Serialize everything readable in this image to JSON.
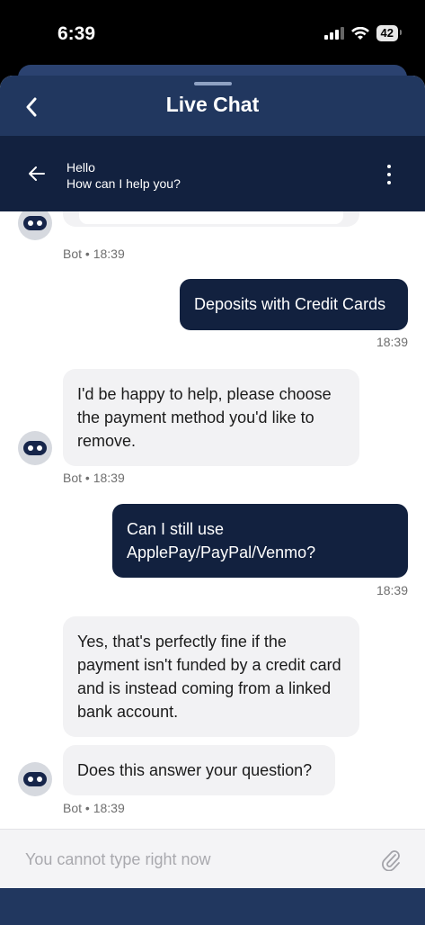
{
  "status_bar": {
    "time": "6:39",
    "battery": "42"
  },
  "header": {
    "title": "Live Chat"
  },
  "subheader": {
    "title": "Hello",
    "subtitle": "How can I help you?"
  },
  "messages": [
    {
      "sender": "Bot",
      "time": "18:39"
    },
    {
      "sender": "user",
      "text": "Deposits with Credit Cards",
      "time": "18:39"
    },
    {
      "sender": "Bot",
      "text": "I'd be happy to help, please choose the payment method you'd like to remove.",
      "time": "18:39"
    },
    {
      "sender": "user",
      "text": "Can I still use ApplePay/PayPal/Venmo?",
      "time": "18:39"
    },
    {
      "sender": "Bot",
      "text": "Yes, that's perfectly fine if the payment isn't funded by a credit card and is instead coming from a linked bank account."
    },
    {
      "sender": "Bot",
      "text": "Does this answer your question?",
      "time": "18:39"
    }
  ],
  "meta_sep": "•",
  "input": {
    "placeholder": "You cannot type right now"
  },
  "icons": {
    "back": "chevron-left-icon",
    "sub_back": "arrow-left-icon",
    "menu": "more-vertical-icon",
    "attach": "paperclip-icon",
    "bot": "bot-avatar-icon"
  },
  "colors": {
    "header": "#21375f",
    "subheader": "#12213f",
    "user_bubble": "#12213f",
    "bot_bubble": "#f2f2f4"
  }
}
